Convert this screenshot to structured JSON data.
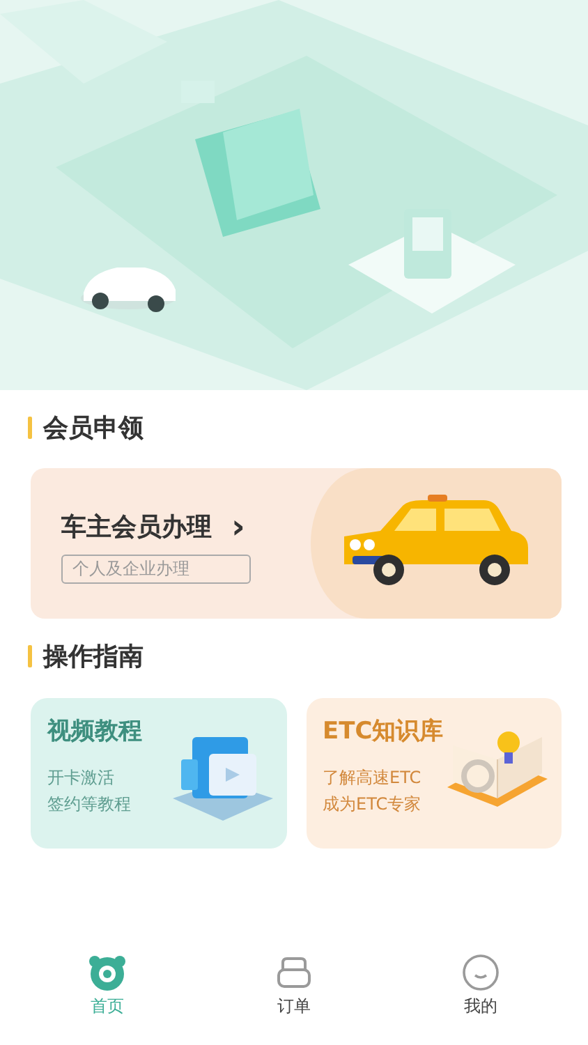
{
  "member_section": {
    "title": "会员申领",
    "card": {
      "title": "车主会员办理",
      "arrow": "›",
      "tag": "个人及企业办理"
    }
  },
  "guide_section": {
    "title": "操作指南",
    "cards": [
      {
        "kind": "video",
        "title": "视频教程",
        "lines": [
          "开卡激活",
          "签约等教程"
        ]
      },
      {
        "kind": "knowledge",
        "title": "ETC知识库",
        "lines": [
          "了解高速ETC",
          "成为ETC专家"
        ]
      }
    ]
  },
  "tab_bar": [
    {
      "kind": "home",
      "label": "首页",
      "selected": true
    },
    {
      "kind": "orders",
      "label": "订单",
      "selected": false
    },
    {
      "kind": "mine",
      "label": "我的",
      "selected": false
    }
  ]
}
